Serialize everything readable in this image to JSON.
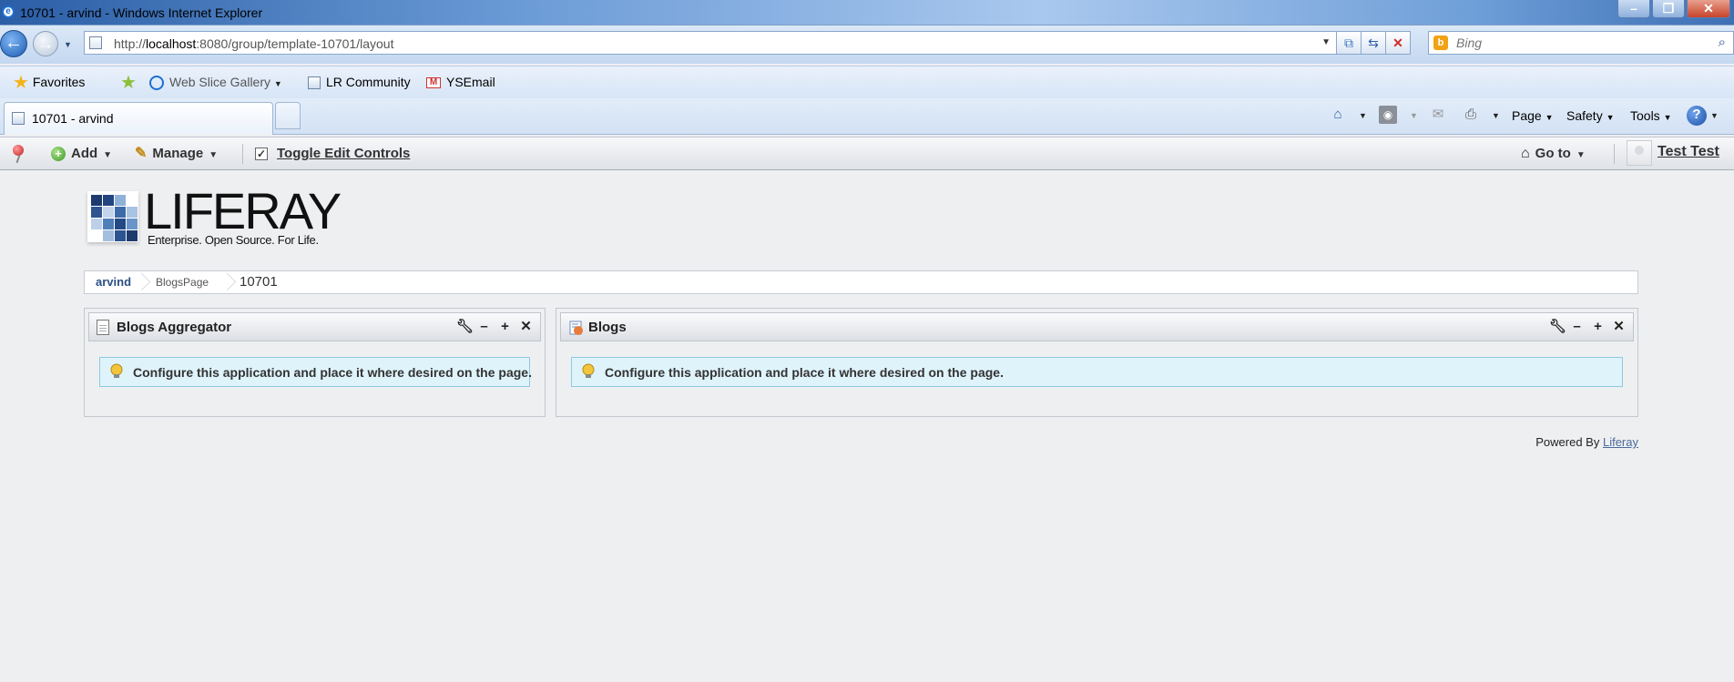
{
  "window": {
    "title": "10701 - arvind - Windows Internet Explorer"
  },
  "address_bar": {
    "url_prefix": "http://",
    "url_host": "localhost",
    "url_rest": ":8080/group/template-10701/layout"
  },
  "search": {
    "placeholder": "Bing"
  },
  "favorites_bar": {
    "favorites_label": "Favorites",
    "items": [
      {
        "label": "Web Slice Gallery"
      },
      {
        "label": "LR Community"
      },
      {
        "label": "YSEmail"
      }
    ]
  },
  "tabs": [
    {
      "label": "10701 - arvind"
    }
  ],
  "command_bar": {
    "page_label": "Page",
    "safety_label": "Safety",
    "tools_label": "Tools"
  },
  "dockbar": {
    "add_label": "Add",
    "manage_label": "Manage",
    "toggle_label": "Toggle Edit Controls",
    "goto_label": "Go to",
    "user_name": "Test Test"
  },
  "logo": {
    "name": "LIFERAY",
    "tagline": "Enterprise. Open Source. For Life."
  },
  "breadcrumb": [
    {
      "label": "arvind"
    },
    {
      "label": "BlogsPage"
    },
    {
      "label": "10701"
    }
  ],
  "portlets": [
    {
      "title": "Blogs Aggregator",
      "message": "Configure this application and place it where desired on the page."
    },
    {
      "title": "Blogs",
      "message": "Configure this application and place it where desired on the page."
    }
  ],
  "footer": {
    "powered_by": "Powered By",
    "link": "Liferay"
  },
  "colors": {
    "accent": "#4a6a9a",
    "info_bg": "#dff3fb"
  }
}
